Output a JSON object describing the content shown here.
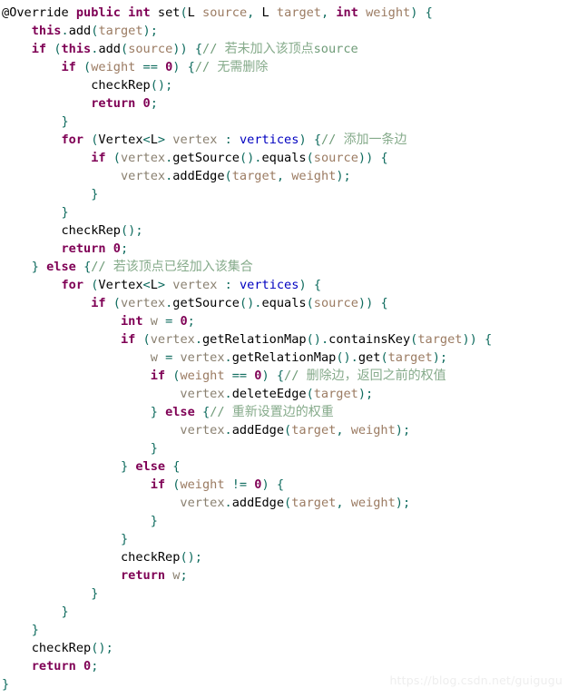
{
  "document": {
    "kind": "code-snippet",
    "language": "Java",
    "background_color": "#ffffff",
    "font_size_px": 13.6,
    "line_height_px": 20,
    "total_lines": 38
  },
  "theme": {
    "annotation_color": "#808080",
    "keyword_color": "#7f0055",
    "method_color": "#000000",
    "parameter_color": "#9b7b62",
    "local_var_color": "#8a8070",
    "field_color": "#0000c0",
    "number_color": "#7f0055",
    "punctuation_color": "#0e6b5e",
    "comment_color": "#86ab8b",
    "plain_color": "#000000",
    "watermark_color": "#eeeeee"
  },
  "watermark": {
    "text": "https://blog.csdn.net/guigugu"
  },
  "code": {
    "lines": [
      {
        "n": 1,
        "indent": 0,
        "text": "@Override public int set(L source, L target, int weight) {"
      },
      {
        "n": 2,
        "indent": 1,
        "text": "this.add(target);"
      },
      {
        "n": 3,
        "indent": 1,
        "text": "if (this.add(source)) {// 若未加入该顶点source"
      },
      {
        "n": 4,
        "indent": 2,
        "text": "if (weight == 0) {// 无需删除"
      },
      {
        "n": 5,
        "indent": 3,
        "text": "checkRep();"
      },
      {
        "n": 6,
        "indent": 3,
        "text": "return 0;"
      },
      {
        "n": 7,
        "indent": 2,
        "text": "}"
      },
      {
        "n": 8,
        "indent": 2,
        "text": "for (Vertex<L> vertex : vertices) {// 添加一条边"
      },
      {
        "n": 9,
        "indent": 3,
        "text": "if (vertex.getSource().equals(source)) {"
      },
      {
        "n": 10,
        "indent": 4,
        "text": "vertex.addEdge(target, weight);"
      },
      {
        "n": 11,
        "indent": 3,
        "text": "}"
      },
      {
        "n": 12,
        "indent": 2,
        "text": "}"
      },
      {
        "n": 13,
        "indent": 2,
        "text": "checkRep();"
      },
      {
        "n": 14,
        "indent": 2,
        "text": "return 0;"
      },
      {
        "n": 15,
        "indent": 1,
        "text": "} else {// 若该顶点已经加入该集合"
      },
      {
        "n": 16,
        "indent": 2,
        "text": "for (Vertex<L> vertex : vertices) {"
      },
      {
        "n": 17,
        "indent": 3,
        "text": "if (vertex.getSource().equals(source)) {"
      },
      {
        "n": 18,
        "indent": 4,
        "text": "int w = 0;"
      },
      {
        "n": 19,
        "indent": 4,
        "text": "if (vertex.getRelationMap().containsKey(target)) {"
      },
      {
        "n": 20,
        "indent": 5,
        "text": "w = vertex.getRelationMap().get(target);"
      },
      {
        "n": 21,
        "indent": 5,
        "text": "if (weight == 0) {// 删除边，返回之前的权值"
      },
      {
        "n": 22,
        "indent": 6,
        "text": "vertex.deleteEdge(target);"
      },
      {
        "n": 23,
        "indent": 5,
        "text": "} else {// 重新设置边的权重"
      },
      {
        "n": 24,
        "indent": 6,
        "text": "vertex.addEdge(target, weight);"
      },
      {
        "n": 25,
        "indent": 5,
        "text": "}"
      },
      {
        "n": 26,
        "indent": 4,
        "text": "} else {"
      },
      {
        "n": 27,
        "indent": 5,
        "text": "if (weight != 0) {"
      },
      {
        "n": 28,
        "indent": 6,
        "text": "vertex.addEdge(target, weight);"
      },
      {
        "n": 29,
        "indent": 5,
        "text": "}"
      },
      {
        "n": 30,
        "indent": 4,
        "text": "}"
      },
      {
        "n": 31,
        "indent": 4,
        "text": "checkRep();"
      },
      {
        "n": 32,
        "indent": 4,
        "text": "return w;"
      },
      {
        "n": 33,
        "indent": 3,
        "text": "}"
      },
      {
        "n": 34,
        "indent": 2,
        "text": "}"
      },
      {
        "n": 35,
        "indent": 1,
        "text": "}"
      },
      {
        "n": 36,
        "indent": 1,
        "text": "checkRep();"
      },
      {
        "n": 37,
        "indent": 1,
        "text": "return 0;"
      },
      {
        "n": 38,
        "indent": 0,
        "text": "}"
      }
    ],
    "method_signature": {
      "annotation": "@Override",
      "modifier": "public",
      "return_type": "int",
      "name": "set",
      "parameters": [
        "L source",
        "L target",
        "int weight"
      ]
    },
    "comments": [
      "// 若未加入该顶点source",
      "// 无需删除",
      "// 添加一条边",
      "// 若该顶点已经加入该集合",
      "// 删除边，返回之前的权值",
      "// 重新设置边的权重"
    ],
    "keywords": [
      "public",
      "int",
      "this",
      "if",
      "return",
      "for",
      "else"
    ],
    "identifiers": {
      "fields": [
        "vertices"
      ],
      "locals": [
        "vertex",
        "w"
      ],
      "parameters": [
        "source",
        "target",
        "weight"
      ],
      "methods": [
        "set",
        "add",
        "checkRep",
        "getSource",
        "equals",
        "addEdge",
        "getRelationMap",
        "containsKey",
        "get",
        "deleteEdge"
      ],
      "types": [
        "L",
        "Vertex"
      ]
    }
  }
}
